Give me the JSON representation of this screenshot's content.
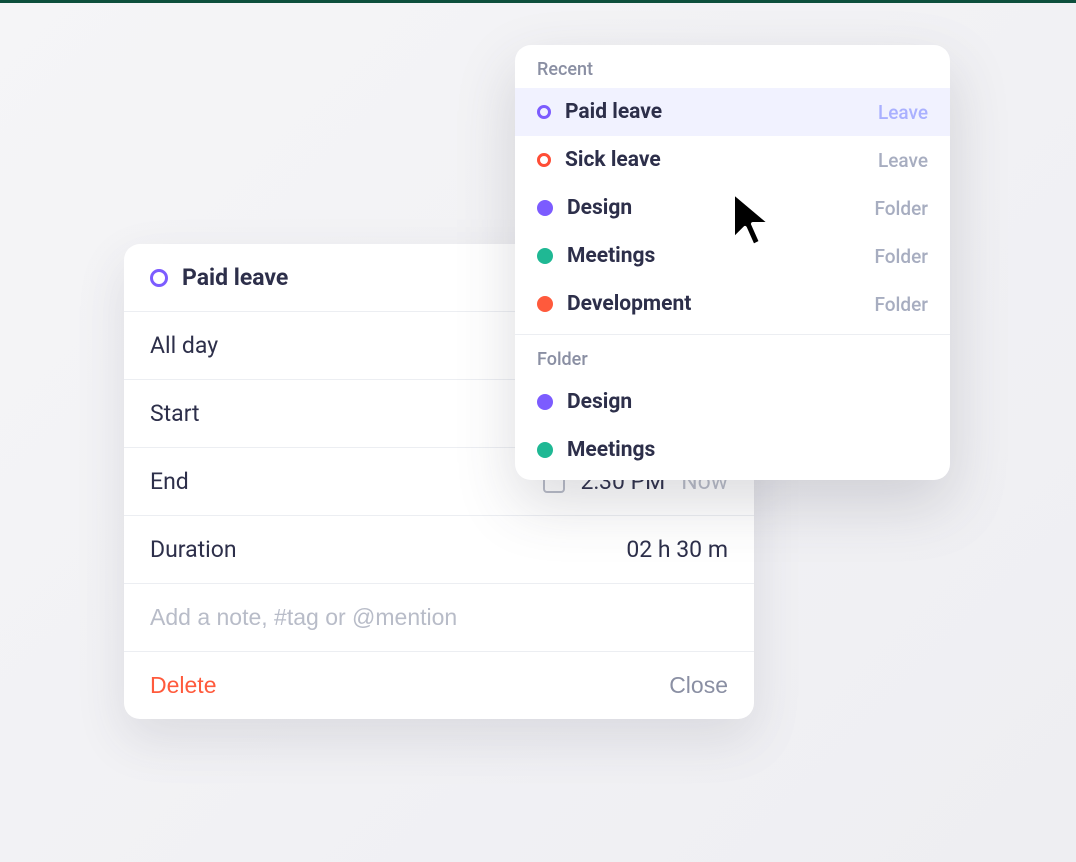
{
  "entry": {
    "title": "Paid leave",
    "icon_color": "#7c5cff",
    "all_day_label": "All day",
    "start_label": "Start",
    "end_label": "End",
    "end_time": "2:30 PM",
    "end_now": "Now",
    "duration_label": "Duration",
    "duration_value": "02 h  30 m",
    "note_placeholder": "Add a note, #tag or @mention",
    "delete_label": "Delete",
    "close_label": "Close"
  },
  "dropdown": {
    "section_recent": "Recent",
    "section_folder": "Folder",
    "recent": [
      {
        "name": "Paid leave",
        "type": "Leave",
        "color": "#7c5cff",
        "style": "ring",
        "selected": true
      },
      {
        "name": "Sick leave",
        "type": "Leave",
        "color": "#ff4d36",
        "style": "ring",
        "selected": false
      },
      {
        "name": "Design",
        "type": "Folder",
        "color": "#7c5cff",
        "style": "solid",
        "selected": false
      },
      {
        "name": "Meetings",
        "type": "Folder",
        "color": "#1fb894",
        "style": "solid",
        "selected": false
      },
      {
        "name": "Development",
        "type": "Folder",
        "color": "#ff5a3c",
        "style": "solid",
        "selected": false
      }
    ],
    "folders": [
      {
        "name": "Design",
        "color": "#7c5cff",
        "style": "solid"
      },
      {
        "name": "Meetings",
        "color": "#1fb894",
        "style": "solid"
      }
    ]
  }
}
